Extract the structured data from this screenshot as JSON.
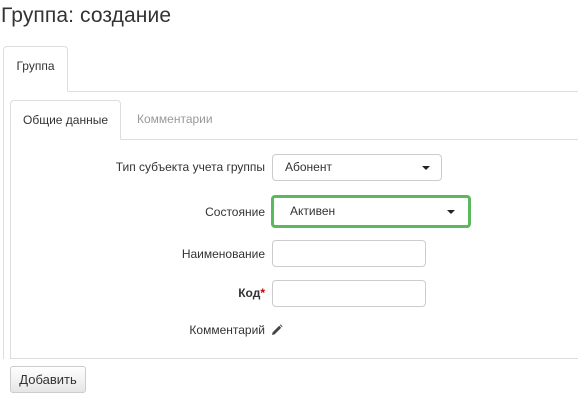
{
  "page": {
    "title": "Группа: создание"
  },
  "outer_tabs": [
    {
      "label": "Группа",
      "active": true
    }
  ],
  "inner_tabs": [
    {
      "label": "Общие данные",
      "active": true
    },
    {
      "label": "Комментарии",
      "active": false
    }
  ],
  "form": {
    "subject_type": {
      "label": "Тип субъекта учета группы",
      "value": "Абонент"
    },
    "state": {
      "label": "Состояние",
      "value": "Активен",
      "highlight_color": "#5cb85c"
    },
    "name": {
      "label": "Наименование",
      "value": ""
    },
    "code": {
      "label": "Код",
      "required_mark": "*",
      "value": ""
    },
    "comment": {
      "label": "Комментарий",
      "icon": "pencil-icon"
    }
  },
  "actions": {
    "add_label": "Добавить"
  }
}
